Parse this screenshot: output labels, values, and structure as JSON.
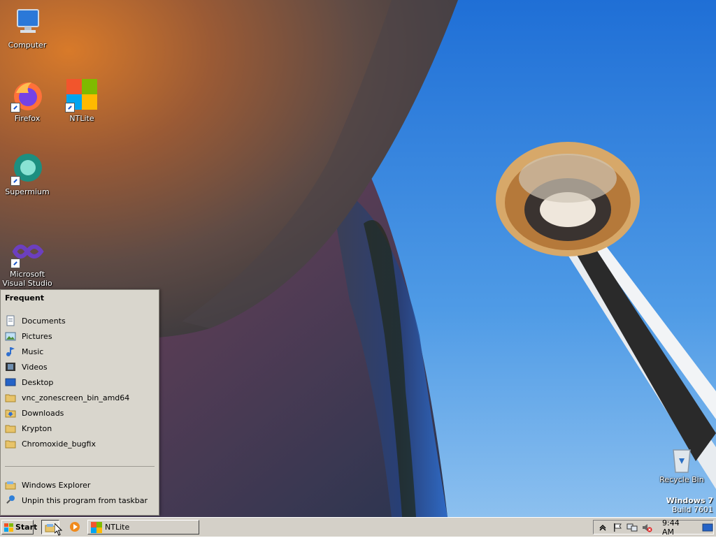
{
  "desktop": {
    "icons": [
      {
        "label": "Computer",
        "icon": "computer-icon"
      },
      {
        "label": "Firefox",
        "icon": "firefox-icon"
      },
      {
        "label": "NTLite",
        "icon": "ntlite-icon"
      },
      {
        "label": "Supermium",
        "icon": "supermium-icon"
      },
      {
        "label": "Microsoft Visual Studio 2010",
        "icon": "visual-studio-icon"
      },
      {
        "label": "Recycle Bin",
        "icon": "recycle-bin-icon"
      }
    ],
    "watermark": {
      "line1": "Windows 7",
      "line2": "Build 7601"
    }
  },
  "jumplist": {
    "heading": "Frequent",
    "items": [
      {
        "label": "Documents",
        "icon": "documents-icon"
      },
      {
        "label": "Pictures",
        "icon": "pictures-icon"
      },
      {
        "label": "Music",
        "icon": "music-icon"
      },
      {
        "label": "Videos",
        "icon": "videos-icon"
      },
      {
        "label": "Desktop",
        "icon": "desktop-icon"
      },
      {
        "label": "vnc_zonescreen_bin_amd64",
        "icon": "folder-icon"
      },
      {
        "label": "Downloads",
        "icon": "downloads-icon"
      },
      {
        "label": "Krypton",
        "icon": "folder-icon"
      },
      {
        "label": "Chromoxide_bugfix",
        "icon": "folder-icon"
      }
    ],
    "tasks": [
      {
        "label": "Windows Explorer",
        "icon": "explorer-icon"
      },
      {
        "label": "Unpin this program from taskbar",
        "icon": "unpin-icon"
      }
    ]
  },
  "taskbar": {
    "start_label": "Start",
    "quick_launch": [
      {
        "name": "windows-explorer",
        "icon": "explorer-icon"
      },
      {
        "name": "media-player",
        "icon": "media-player-icon"
      }
    ],
    "task_button_label": "NTLite",
    "tray": {
      "time": "9:44 AM"
    }
  },
  "colors": {
    "taskbar": "#d4d0c8",
    "jumplist": "#d9d6cd",
    "sky": "#3f8fe0"
  }
}
